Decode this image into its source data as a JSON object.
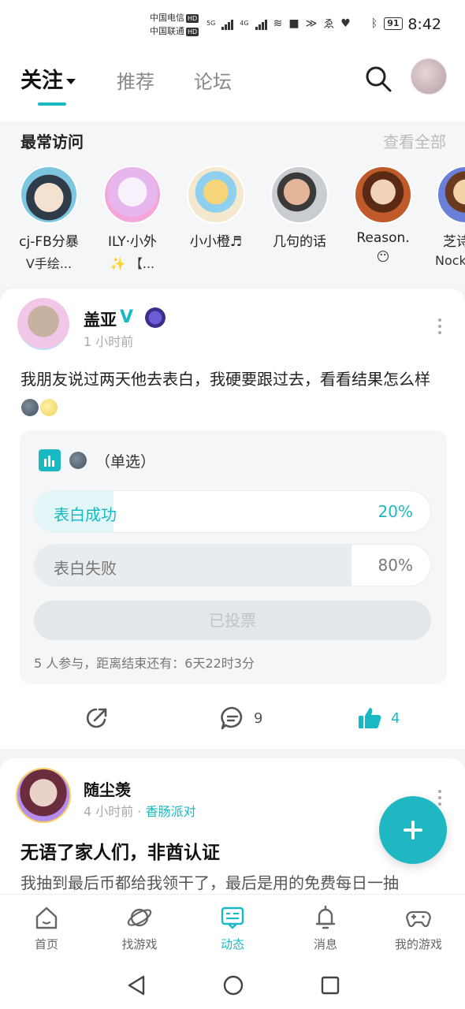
{
  "status_bar": {
    "carrier1": "中国电信",
    "carrier2": "中国联通",
    "hd": "HD",
    "net1": "5G",
    "net2": "4G",
    "battery": "91",
    "time": "8:42"
  },
  "top_nav": {
    "tabs": [
      {
        "label": "关注",
        "active": true
      },
      {
        "label": "推荐",
        "active": false
      },
      {
        "label": "论坛",
        "active": false
      }
    ]
  },
  "frequent": {
    "title": "最常访问",
    "view_all": "查看全部",
    "users": [
      {
        "name": "cj-FB分暴",
        "sub": "V手绘...",
        "color": "#7cc6e0"
      },
      {
        "name": "ILY·小外",
        "sub": "✨ 【...",
        "color": "#e8b6ef"
      },
      {
        "name": "小小橙♬",
        "sub": "",
        "color": "#f4e0b4"
      },
      {
        "name": "几句的话",
        "sub": "",
        "color": "#c4c8cf"
      },
      {
        "name": "Reason.",
        "sub": "😶",
        "color": "#c05a2a"
      },
      {
        "name": "芝诗",
        "sub": "Nock",
        "color": "#6a7fd8"
      }
    ]
  },
  "post1": {
    "author": "盖亚",
    "verified": "V",
    "time": "1 小时前",
    "text": "我朋友说过两天他去表白，我硬要跟过去，看看结果怎么样",
    "poll": {
      "type_label": "（单选）",
      "options": [
        {
          "label": "表白成功",
          "pct": "20%",
          "fraction": 0.2,
          "selected": true
        },
        {
          "label": "表白失败",
          "pct": "80%",
          "fraction": 0.8,
          "selected": false
        }
      ],
      "voted_label": "已投票",
      "footer": "5 人参与，距离结束还有：6天22时3分"
    },
    "actions": {
      "comments": "9",
      "likes": "4"
    }
  },
  "post2": {
    "author": "随尘羡",
    "time": "4 小时前",
    "dot": "·",
    "forum": "香肠派对",
    "title": "无语了家人们，非酋认证",
    "body": "我抽到最后币都给我领干了，最后是用的免费每日一抽"
  },
  "bottom_nav": {
    "items": [
      {
        "label": "首页",
        "active": false
      },
      {
        "label": "找游戏",
        "active": false
      },
      {
        "label": "动态",
        "active": true
      },
      {
        "label": "消息",
        "active": false
      },
      {
        "label": "我的游戏",
        "active": false
      }
    ]
  },
  "colors": {
    "accent": "#19b9c3",
    "poll_selected_fill": "#e4f7f8",
    "poll_other_fill": "#e8ecee"
  }
}
